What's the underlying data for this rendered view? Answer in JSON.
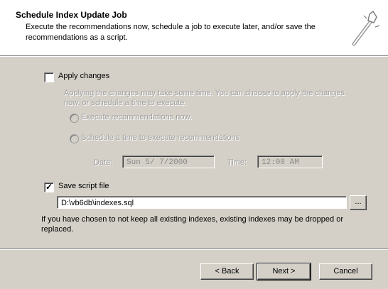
{
  "header": {
    "title": "Schedule Index Update Job",
    "subtitle": "Execute the recommendations now, schedule a job to execute later, and/or save the recommendations as a script."
  },
  "apply": {
    "label": "Apply changes",
    "checked": false,
    "description": "Applying the changes may take some time. You can choose to apply the changes now, or schedule a time to execute.",
    "radio_now": "Execute recommendations now.",
    "radio_schedule": "Schedule a time to execute recommendations",
    "date_label": "Date:",
    "date_value": "Sun 5/ 7/2000",
    "time_label": "Time:",
    "time_value": "12:00 AM"
  },
  "save": {
    "label": "Save script file",
    "checked": true,
    "path_value": "D:\\vb6db\\indexes.sql",
    "browse_label": "...",
    "note": "If you have chosen to not keep all existing indexes, existing indexes may be dropped or replaced."
  },
  "footer": {
    "back_label": "< Back",
    "next_label": "Next >",
    "cancel_label": "Cancel"
  },
  "icons": {
    "wizard": "wand-icon"
  },
  "colors": {
    "dialog_bg": "#d4d0c8",
    "header_bg": "#ffffff",
    "disabled_text": "#a0a0a0"
  }
}
